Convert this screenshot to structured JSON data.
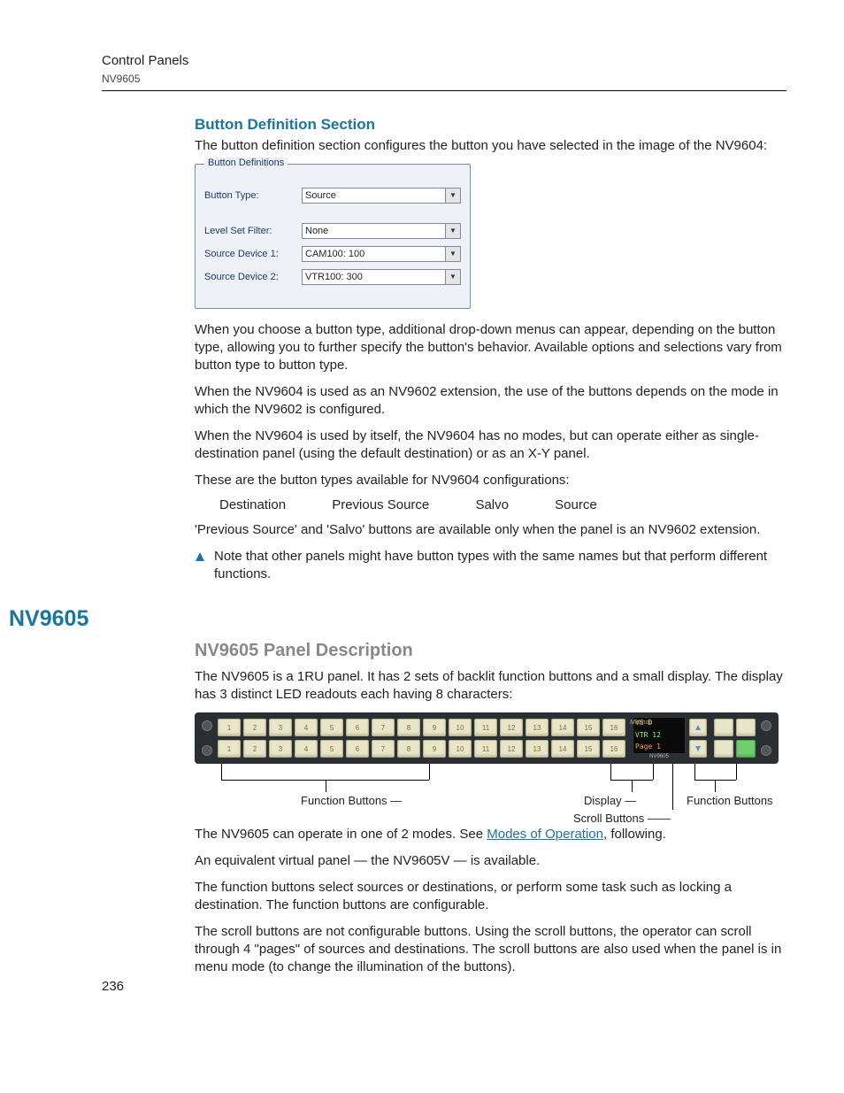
{
  "header": {
    "title": "Control Panels",
    "subtitle": "NV9605"
  },
  "bd_section": {
    "heading": "Button Definition Section",
    "intro": "The button definition section configures the button you have selected in the image of the NV9604:",
    "panel_legend": "Button Definitions",
    "rows": [
      {
        "label": "Button Type:",
        "value": "Source"
      },
      {
        "label": "Level Set Filter:",
        "value": "None"
      },
      {
        "label": "Source Device 1:",
        "value": "CAM100: 100"
      },
      {
        "label": "Source Device 2:",
        "value": "VTR100: 300"
      }
    ],
    "para_behavior": "When you choose a button type, additional drop-down menus can appear, depending on the button type, allowing you to further specify the button's behavior. Available options and selections vary from button type to button type.",
    "para_ext": "When the NV9604 is used as an NV9602 extension, the use of the buttons depends on the mode in which the NV9602 is configured.",
    "para_itself": "When the NV9604 is used by itself, the NV9604 has no modes, but can operate either as single-destination panel (using the default destination) or as an X-Y panel.",
    "para_types_intro": "These are the button types available for NV9604 configurations:",
    "types": [
      "Destination",
      "Previous Source",
      "Salvo",
      "Source"
    ],
    "para_prevsalvo": "'Previous Source' and 'Salvo' buttons are available only when the panel is an NV9602 extension.",
    "note": "Note that other panels might have button types with the same names but that perform different functions."
  },
  "nv9605": {
    "heading": "NV9605",
    "sub": "NV9605 Panel Description",
    "intro": "The NV9605 is a 1RU panel. It has 2 sets of backlit function buttons and a small display. The display has 3 distinct LED readouts each having 8 characters:",
    "diagram": {
      "brand": "Miranda",
      "model": "NV9605",
      "lcd_lines": [
        "VS    D",
        "VTR 12",
        "Page 1"
      ],
      "row1_count": 16,
      "row2_count": 16,
      "callout_func": "Function Buttons",
      "callout_display": "Display",
      "callout_scroll": "Scroll Buttons",
      "callout_func_right": "Function Buttons"
    },
    "para_modes_pre": "The NV9605 can operate in one of 2 modes. See ",
    "link_modes": "Modes of Operation",
    "para_modes_post": ", following.",
    "para_virtual": "An equivalent virtual panel — the NV9605V — is available.",
    "para_func": "The function buttons select sources or destinations, or perform some task such as locking a destination. The function buttons are configurable.",
    "para_scroll": "The scroll buttons are not configurable buttons. Using the scroll buttons, the operator can scroll through 4 \"pages\" of sources and destinations. The scroll buttons are also used when the panel is in menu mode (to change the illumination of the buttons)."
  },
  "page_number": "236"
}
